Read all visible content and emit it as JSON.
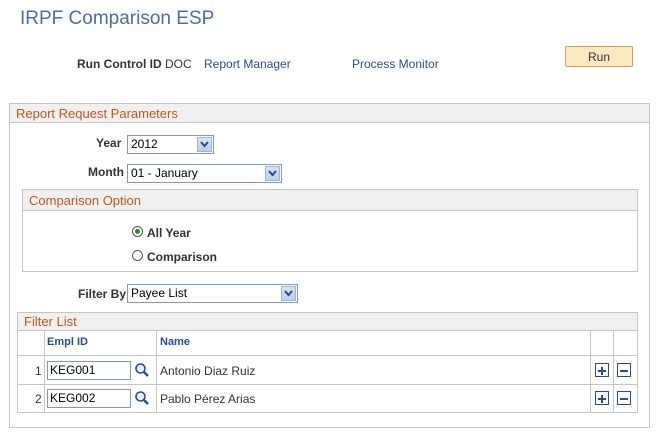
{
  "page": {
    "title": "IRPF Comparison ESP"
  },
  "header": {
    "run_control_label": "Run Control ID",
    "run_control_value": "DOC",
    "report_manager": "Report Manager",
    "process_monitor": "Process Monitor",
    "run_button": "Run"
  },
  "params": {
    "title": "Report Request Parameters",
    "year_label": "Year",
    "year_value": "2012",
    "month_label": "Month",
    "month_value": "01 - January"
  },
  "comparison": {
    "title": "Comparison Option",
    "options": [
      {
        "label": "All Year",
        "selected": true
      },
      {
        "label": "Comparison",
        "selected": false
      }
    ]
  },
  "filter": {
    "label": "Filter By",
    "value": "Payee List"
  },
  "filter_list": {
    "title": "Filter List",
    "columns": [
      "Empl ID",
      "Name"
    ],
    "rows": [
      {
        "num": "1",
        "empl_id": "KEG001",
        "name": "Antonio Diaz Ruiz"
      },
      {
        "num": "2",
        "empl_id": "KEG002",
        "name": "Pablo Pérez Arias"
      }
    ]
  },
  "colors": {
    "accent": "#4a6ea8",
    "header_text": "#c1581b",
    "link": "#2b4d8c",
    "run_button_bg": "#fde9bf"
  },
  "icons": {
    "lookup": "magnifier-icon",
    "add_row": "plus-icon",
    "delete_row": "minus-icon",
    "dropdown": "chevron-down-icon"
  }
}
